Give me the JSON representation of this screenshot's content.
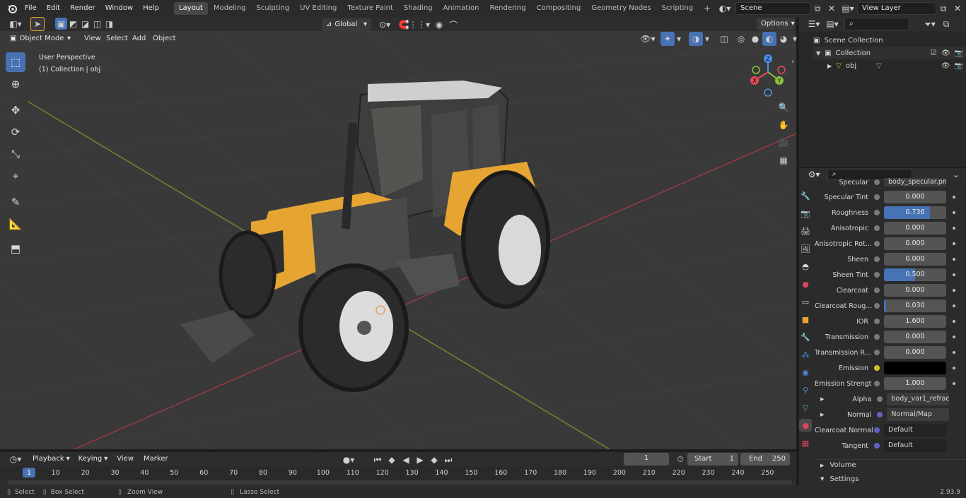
{
  "menu": {
    "items": [
      "File",
      "Edit",
      "Render",
      "Window",
      "Help"
    ]
  },
  "workspaces": [
    "Layout",
    "Modeling",
    "Sculpting",
    "UV Editing",
    "Texture Paint",
    "Shading",
    "Animation",
    "Rendering",
    "Compositing",
    "Geometry Nodes",
    "Scripting"
  ],
  "active_workspace": "Layout",
  "scene": {
    "name": "Scene"
  },
  "view_layer": {
    "name": "View Layer"
  },
  "toolbar": {
    "orientation": "Global",
    "options_label": "Options"
  },
  "viewport_header": {
    "mode": "Object Mode",
    "menus": [
      "View",
      "Select",
      "Add",
      "Object"
    ]
  },
  "viewport": {
    "perspective": "User Perspective",
    "collection_info": "(1) Collection | obj"
  },
  "gizmo": {
    "z": "Z",
    "y": "Y",
    "x": "X"
  },
  "outliner": {
    "root": "Scene Collection",
    "collection": "Collection",
    "object": "obj"
  },
  "properties": {
    "top_partial": {
      "label": "Specular",
      "value": "body_specular.png"
    },
    "rows": [
      {
        "label": "Specular Tint",
        "value": "0.000",
        "fill": 0
      },
      {
        "label": "Roughness",
        "value": "0.736",
        "fill": 0.736
      },
      {
        "label": "Anisotropic",
        "value": "0.000",
        "fill": 0
      },
      {
        "label": "Anisotropic Rot...",
        "value": "0.000",
        "fill": 0
      },
      {
        "label": "Sheen",
        "value": "0.000",
        "fill": 0
      },
      {
        "label": "Sheen Tint",
        "value": "0.500",
        "fill": 0.5
      },
      {
        "label": "Clearcoat",
        "value": "0.000",
        "fill": 0
      },
      {
        "label": "Clearcoat Roug...",
        "value": "0.030",
        "fill": 0.03
      },
      {
        "label": "IOR",
        "value": "1.600",
        "fill": 0
      },
      {
        "label": "Transmission",
        "value": "0.000",
        "fill": 0
      },
      {
        "label": "Transmission R...",
        "value": "0.000",
        "fill": 0
      },
      {
        "label": "Emission",
        "value": "",
        "fill": 0
      },
      {
        "label": "Emission Strengt",
        "value": "1.000",
        "fill": 0
      }
    ],
    "alpha": {
      "label": "Alpha",
      "value": "body_var1_refractio..."
    },
    "normal": {
      "label": "Normal",
      "value": "Normal/Map"
    },
    "clearcoat_normal": {
      "label": "Clearcoat Normal",
      "value": "Default"
    },
    "tangent": {
      "label": "Tangent",
      "value": "Default"
    },
    "sections": [
      "Volume",
      "Settings"
    ]
  },
  "timeline": {
    "menus": [
      "Playback",
      "Keying",
      "View",
      "Marker"
    ],
    "current_frame": "1",
    "start_label": "Start",
    "start": "1",
    "end_label": "End",
    "end": "250",
    "ruler": [
      "1",
      "10",
      "20",
      "30",
      "40",
      "50",
      "60",
      "70",
      "80",
      "90",
      "100",
      "110",
      "120",
      "130",
      "140",
      "150",
      "160",
      "170",
      "180",
      "190",
      "200",
      "210",
      "220",
      "230",
      "240",
      "250"
    ]
  },
  "status": {
    "select": "Select",
    "box_select": "Box Select",
    "zoom_view": "Zoom View",
    "lasso_select": "Lasso Select",
    "version": "2.93.9"
  },
  "colors": {
    "accent": "#4772b3",
    "x_axis": "#e64a5a",
    "y_axis": "#8ac33e",
    "z_axis": "#4f8ee6",
    "body_yellow": "#e6a533"
  }
}
